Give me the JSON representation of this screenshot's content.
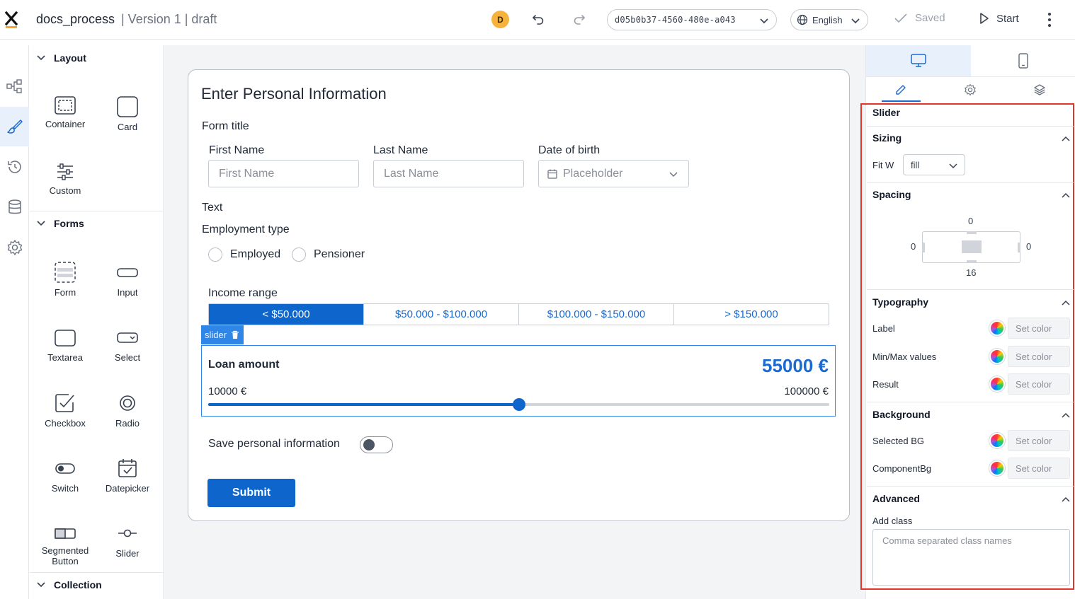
{
  "header": {
    "logo_text": "x",
    "app_name": "docs_process",
    "version": "| Version 1 | draft",
    "avatar_initial": "D",
    "process_id": "d05b0b37-4560-480e-a043",
    "language": "English",
    "saved_label": "Saved",
    "start_label": "Start"
  },
  "rail": {
    "icons": [
      "process-map-icon",
      "brush-icon",
      "history-icon",
      "database-icon",
      "settings-gear-icon"
    ],
    "active_index": 1
  },
  "palette": {
    "layout": {
      "title": "Layout",
      "items": [
        {
          "label": "Container",
          "icon": "container-icon"
        },
        {
          "label": "Card",
          "icon": "card-icon"
        },
        {
          "label": "Custom",
          "icon": "custom-sliders-icon"
        }
      ]
    },
    "forms": {
      "title": "Forms",
      "items": [
        {
          "label": "Form",
          "icon": "form-icon"
        },
        {
          "label": "Input",
          "icon": "input-icon"
        },
        {
          "label": "Textarea",
          "icon": "textarea-icon"
        },
        {
          "label": "Select",
          "icon": "select-icon"
        },
        {
          "label": "Checkbox",
          "icon": "checkbox-icon"
        },
        {
          "label": "Radio",
          "icon": "radio-icon"
        },
        {
          "label": "Switch",
          "icon": "switch-icon"
        },
        {
          "label": "Datepicker",
          "icon": "datepicker-icon"
        },
        {
          "label": "Segmented\nButton",
          "icon": "segmented-button-icon"
        },
        {
          "label": "Slider",
          "icon": "slider-icon"
        }
      ]
    },
    "collection": {
      "title": "Collection"
    }
  },
  "form": {
    "title": "Enter Personal Information",
    "form_title": "Form title",
    "first_name": {
      "label": "First Name",
      "placeholder": "First Name"
    },
    "last_name": {
      "label": "Last Name",
      "placeholder": "Last Name"
    },
    "date_of_birth": {
      "label": "Date of birth",
      "placeholder": "Placeholder"
    },
    "text_label": "Text",
    "employment": {
      "label": "Employment type",
      "options": [
        "Employed",
        "Pensioner"
      ]
    },
    "income": {
      "label": "Income range",
      "options": [
        "< $50.000",
        "$50.000 - $100.000",
        "$100.000 - $150.000",
        "> $150.000"
      ],
      "selected_index": 0
    },
    "slider": {
      "tag": "slider",
      "label": "Loan amount",
      "value_display": "55000 €",
      "min_label": "10000 €",
      "max_label": "100000 €",
      "min": 10000,
      "max": 100000,
      "value": 55000
    },
    "save_info": {
      "label": "Save personal information",
      "on": false
    },
    "submit_label": "Submit"
  },
  "properties": {
    "view_tabs": [
      "desktop-icon",
      "mobile-icon"
    ],
    "prop_tabs": [
      "pencil-icon",
      "settings-gear-icon",
      "layers-icon"
    ],
    "component_name": "Slider",
    "sizing": {
      "title": "Sizing",
      "fit_label": "Fit W",
      "fit_value": "fill"
    },
    "spacing": {
      "title": "Spacing",
      "top": "0",
      "left": "0",
      "right": "0",
      "bottom": "16"
    },
    "typography": {
      "title": "Typography",
      "rows": [
        {
          "label": "Label",
          "button": "Set color"
        },
        {
          "label": "Min/Max values",
          "button": "Set color"
        },
        {
          "label": "Result",
          "button": "Set color"
        }
      ]
    },
    "background": {
      "title": "Background",
      "rows": [
        {
          "label": "Selected BG",
          "button": "Set color"
        },
        {
          "label": "ComponentBg",
          "button": "Set color"
        }
      ]
    },
    "advanced": {
      "title": "Advanced",
      "add_class_label": "Add class",
      "add_class_placeholder": "Comma separated class names"
    }
  },
  "colors": {
    "primary": "#0e66cc",
    "accent_blue": "#2f86e6",
    "avatar": "#f5b23d",
    "highlight_frame": "#e5352b"
  }
}
